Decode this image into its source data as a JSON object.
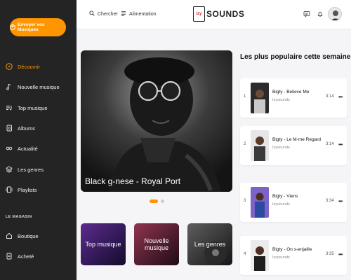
{
  "sidebar": {
    "upload_label": "Envoyer vos Musiques",
    "items": [
      {
        "label": "Découvrir",
        "icon": "compass-icon"
      },
      {
        "label": "Nouvelle musique",
        "icon": "music-note-icon"
      },
      {
        "label": "Top musique",
        "icon": "playlist-icon"
      },
      {
        "label": "Albums",
        "icon": "album-icon"
      },
      {
        "label": "Actualité",
        "icon": "link-icon"
      },
      {
        "label": "Les genres",
        "icon": "layers-icon"
      },
      {
        "label": "Playlists",
        "icon": "playlist-stack-icon"
      }
    ],
    "section_title": "LE MAGASIN",
    "store_items": [
      {
        "label": "Boutique",
        "icon": "home-icon"
      },
      {
        "label": "Acheté",
        "icon": "receipt-icon"
      }
    ],
    "accent": "#ff9500",
    "background": "#242424"
  },
  "topbar": {
    "search_label": "Chercher",
    "feed_label": "Alimentation",
    "logo_mark": "izy",
    "logo_text": "SOUNDS"
  },
  "hero": {
    "title": "Black g-nese - Royal Port"
  },
  "categories": [
    {
      "label": "Top musique"
    },
    {
      "label": "Nouvelle musique"
    },
    {
      "label": "Les genres"
    }
  ],
  "popular": {
    "title": "Les plus populaire cette semaine",
    "tracks": [
      {
        "num": "1",
        "name": "Bigty - Believe Me",
        "artist": "Izysounds",
        "duration": "3:14"
      },
      {
        "num": "2",
        "name": "Bigty - Le M-me Regard",
        "artist": "Izysounds",
        "duration": "3:14"
      },
      {
        "num": "3",
        "name": "Bigty - Viens",
        "artist": "Izysounds",
        "duration": "3:34"
      },
      {
        "num": "4",
        "name": "Bigty - On s-enjaille",
        "artist": "Izysounds",
        "duration": "3:35"
      }
    ]
  }
}
